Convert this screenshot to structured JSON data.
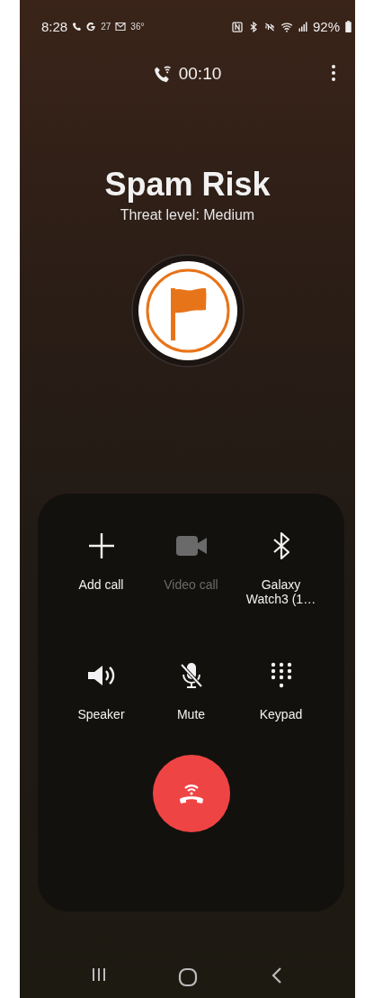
{
  "status_bar": {
    "time": "8:28",
    "badge": "27",
    "temperature": "36°",
    "battery": "92%"
  },
  "call": {
    "timer": "00:10",
    "title": "Spam Risk",
    "subtitle": "Threat level: Medium"
  },
  "controls": [
    {
      "kind": "add",
      "label": "Add call",
      "disabled": false
    },
    {
      "kind": "video",
      "label": "Video call",
      "disabled": true
    },
    {
      "kind": "bluetooth",
      "label": "Galaxy Watch3 (1…",
      "disabled": false
    },
    {
      "kind": "speaker",
      "label": "Speaker",
      "disabled": false
    },
    {
      "kind": "mute",
      "label": "Mute",
      "disabled": false
    },
    {
      "kind": "keypad",
      "label": "Keypad",
      "disabled": false
    }
  ]
}
